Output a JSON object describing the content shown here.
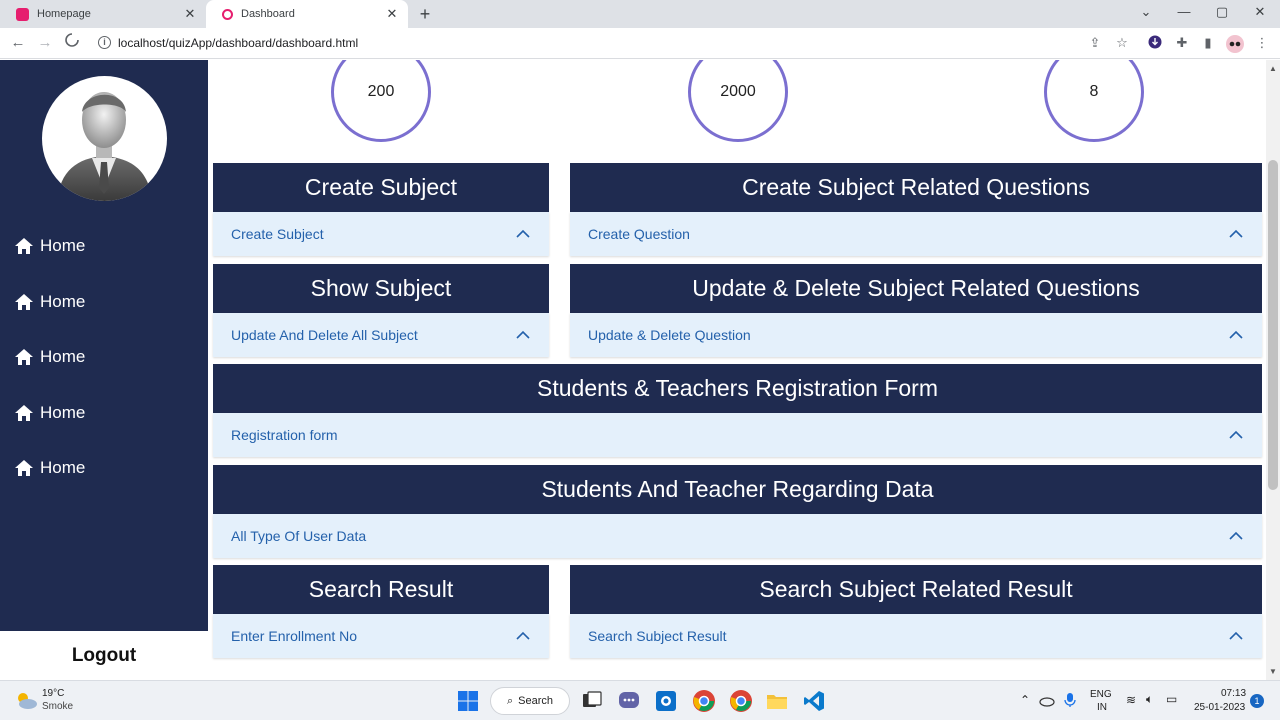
{
  "browser": {
    "tabs": [
      {
        "title": "Homepage",
        "active": false
      },
      {
        "title": "Dashboard",
        "active": true
      }
    ],
    "url": "localhost/quizApp/dashboard/dashboard.html"
  },
  "sidebar": {
    "items": [
      {
        "label": "Home"
      },
      {
        "label": "Home"
      },
      {
        "label": "Home"
      },
      {
        "label": "Home"
      },
      {
        "label": "Home"
      }
    ],
    "logout_label": "Logout"
  },
  "stats": [
    "200",
    "2000",
    "8"
  ],
  "cards": [
    {
      "title": "Create Subject",
      "link": "Create Subject"
    },
    {
      "title": "Create Subject Related Questions",
      "link": "Create Question"
    },
    {
      "title": "Show Subject",
      "link": "Update And Delete All Subject"
    },
    {
      "title": "Update & Delete Subject Related Questions",
      "link": "Update & Delete Question"
    },
    {
      "title": "Students & Teachers Registration Form",
      "link": "Registration form"
    },
    {
      "title": "Students And Teacher Regarding Data",
      "link": "All Type Of User Data"
    },
    {
      "title": "Search Result",
      "link": "Enter Enrollment No"
    },
    {
      "title": "Search Subject Related Result",
      "link": "Search Subject Result"
    }
  ],
  "taskbar": {
    "weather_temp": "19°C",
    "weather_desc": "Smoke",
    "search_label": "Search",
    "lang_1": "ENG",
    "lang_2": "IN",
    "time": "07:13",
    "date": "25-01-2023",
    "notifications": "1"
  },
  "colors": {
    "navy": "#1f2b50",
    "accordion_bg": "#e4f0fb",
    "link_blue": "#2461ab",
    "stat_ring": "#7b6fd0"
  }
}
